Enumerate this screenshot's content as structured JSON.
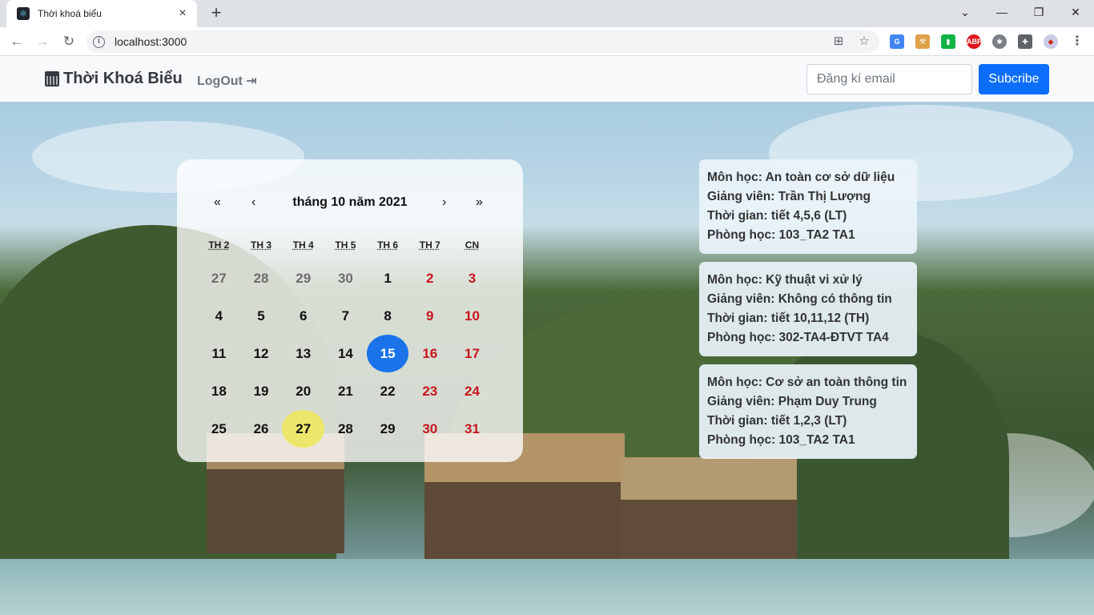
{
  "browser": {
    "tab_title": "Thời khoá biểu",
    "url": "localhost:3000"
  },
  "navbar": {
    "brand": "Thời Khoá Biểu",
    "logout": "LogOut",
    "email_placeholder": "Đăng kí email",
    "subscribe": "Subcribe"
  },
  "calendar": {
    "label": "tháng 10 năm 2021",
    "nav": {
      "prev2": "«",
      "prev": "‹",
      "next": "›",
      "next2": "»"
    },
    "weekdays": [
      "TH 2",
      "TH 3",
      "TH 4",
      "TH 5",
      "TH 6",
      "TH 7",
      "CN"
    ],
    "weeks": [
      [
        "27",
        "28",
        "29",
        "30",
        "1",
        "2",
        "3"
      ],
      [
        "4",
        "5",
        "6",
        "7",
        "8",
        "9",
        "10"
      ],
      [
        "11",
        "12",
        "13",
        "14",
        "15",
        "16",
        "17"
      ],
      [
        "18",
        "19",
        "20",
        "21",
        "22",
        "23",
        "24"
      ],
      [
        "25",
        "26",
        "27",
        "28",
        "29",
        "30",
        "31"
      ]
    ],
    "selected_day": "15",
    "highlighted_day": "27",
    "colors": {
      "today": "#1a73e8",
      "highlight": "#ece76a",
      "weekend": "#c9151e"
    }
  },
  "schedule": [
    {
      "subject": "Môn học: An toàn cơ sở dữ liệu",
      "teacher": "Giảng viên: Trần Thị Lượng",
      "time": "Thời gian: tiết 4,5,6 (LT)",
      "room": "Phòng học: 103_TA2 TA1"
    },
    {
      "subject": "Môn học: Kỹ thuật vi xử lý",
      "teacher": "Giảng viên: Không có thông tin",
      "time": "Thời gian: tiết 10,11,12 (TH)",
      "room": "Phòng học: 302-TA4-ĐTVT TA4"
    },
    {
      "subject": "Môn học: Cơ sở an toàn thông tin",
      "teacher": "Giảng viên: Phạm Duy Trung",
      "time": "Thời gian: tiết 1,2,3 (LT)",
      "room": "Phòng học: 103_TA2 TA1"
    }
  ]
}
